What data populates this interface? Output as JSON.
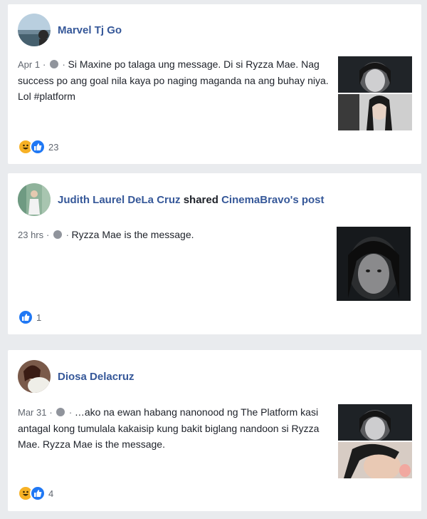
{
  "posts": [
    {
      "author": "Marvel Tj Go",
      "date": "Apr 1",
      "text": "Si Maxine po talaga ung message. Di si Ryzza Mae. Nag success po ang goal nila kaya po naging maganda na ang buhay niya. Lol #platform",
      "reaction_count": "23",
      "reactions": [
        "haha-icon",
        "like-icon"
      ]
    },
    {
      "author": "Judith Laurel DeLa Cruz",
      "shared_word": "shared",
      "shared_target": "CinemaBravo's post",
      "date": "23 hrs",
      "text": "Ryzza Mae is the message.",
      "reaction_count": "1",
      "reactions": [
        "like-icon"
      ]
    },
    {
      "author": "Diosa Delacruz",
      "date": "Mar 31",
      "text": "…ako na ewan habang nanonood ng The Platform kasi antagal kong tumulala kakaisip kung bakit biglang nandoon si Ryzza Mae. Ryzza Mae is the message.",
      "reaction_count": "4",
      "reactions": [
        "haha-icon",
        "like-icon"
      ]
    }
  ],
  "colors": {
    "link": "#365899",
    "like": "#2078f4",
    "haha": "#f7b125",
    "background": "#e9ebee"
  }
}
